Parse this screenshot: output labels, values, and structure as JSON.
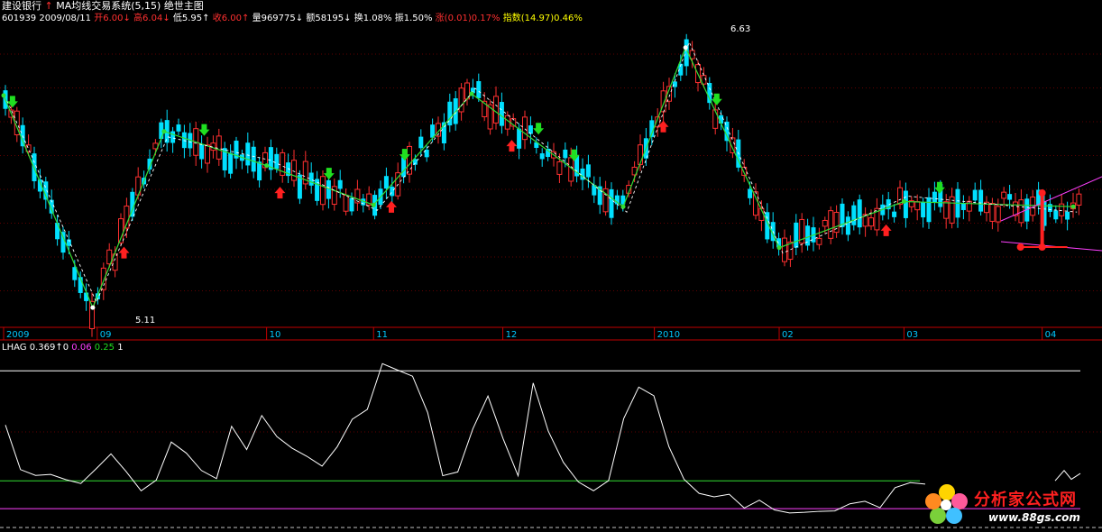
{
  "header": {
    "stock_name": "建设银行",
    "indicator_name": "MA均线交易系统(5,15)",
    "chart_name": "绝世主图",
    "code": "601939",
    "date": "2009/08/11",
    "open_label": "开6.00",
    "high_label": "高6.04",
    "low_label": "低5.95",
    "close_label": "收6.00",
    "volume_label": "量969775",
    "amount_label": "额58195",
    "turnover_label": "换1.08%",
    "amplitude_label": "振1.50%",
    "change_label": "涨(0.01)0.17%",
    "index_label": "指数(14.97)0.46%"
  },
  "sub_header": {
    "name": "LHAG",
    "v1": "0.369",
    "v2": "0",
    "v3": "0.06",
    "v4": "0.25",
    "v5": "1"
  },
  "logo": {
    "text": "分析家公式网",
    "url": "www.88gs.com"
  },
  "colors": {
    "up": "#ff3030",
    "down": "#00e0ff",
    "zigzag": "#33dd33",
    "grid": "#c00000",
    "sub_line": "#ffffff",
    "sub_green": "#33dd33",
    "sub_magenta": "#ff40ff"
  },
  "chart_data": [
    {
      "type": "candlestick",
      "title": "",
      "x_tick_labels": [
        "2009",
        "09",
        "10",
        "11",
        "12",
        "2010",
        "02",
        "03",
        "04"
      ],
      "x_tick_dates": [
        "2009-08-11",
        "2009-09-01",
        "2009-10-09",
        "2009-11-02",
        "2009-12-01",
        "2010-01-04",
        "2010-02-01",
        "2010-03-01",
        "2010-04-01"
      ],
      "annotations": [
        {
          "label": "6.63",
          "date": "2010-01-11",
          "price": 6.63
        },
        {
          "label": "5.11",
          "date": "2009-08-31",
          "price": 5.11
        }
      ],
      "price_range": [
        5.0,
        6.75
      ],
      "zigzag_pivots": [
        {
          "date": "2009-08-11",
          "price": 6.35
        },
        {
          "date": "2009-08-31",
          "price": 5.11
        },
        {
          "date": "2009-09-16",
          "price": 6.14
        },
        {
          "date": "2009-10-09",
          "price": 5.94
        },
        {
          "date": "2009-11-02",
          "price": 5.71
        },
        {
          "date": "2009-11-24",
          "price": 6.36
        },
        {
          "date": "2009-12-28",
          "price": 5.7
        },
        {
          "date": "2010-01-11",
          "price": 6.63
        },
        {
          "date": "2010-02-01",
          "price": 5.46
        },
        {
          "date": "2010-03-01",
          "price": 5.73
        },
        {
          "date": "2010-04-08",
          "price": 5.7
        }
      ],
      "buy_signals": [
        "2009-09-07",
        "2009-10-12",
        "2009-11-06",
        "2009-12-03",
        "2010-01-06",
        "2010-02-25"
      ],
      "sell_signals": [
        "2009-08-13",
        "2009-09-25",
        "2009-10-23",
        "2009-11-09",
        "2009-12-09",
        "2009-12-17",
        "2010-01-18",
        "2010-03-09"
      ]
    },
    {
      "type": "line",
      "title": "LHAG",
      "series": [
        {
          "name": "LHAG",
          "y_range": [
            -0.05,
            1.1
          ]
        }
      ],
      "reference_levels": [
        {
          "value": 0.06,
          "color": "#ff40ff"
        },
        {
          "value": 0.25,
          "color": "#33dd33"
        },
        {
          "value": 1,
          "color": "#ffffff"
        }
      ]
    }
  ]
}
